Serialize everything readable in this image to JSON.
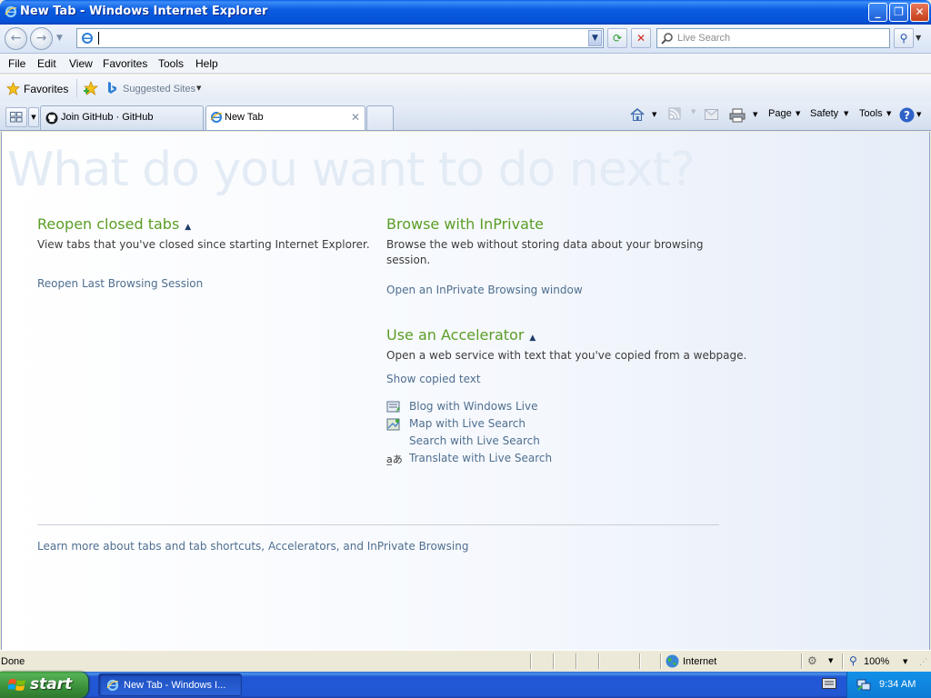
{
  "window": {
    "title": "New Tab - Windows Internet Explorer",
    "minimize": "_",
    "maximize": "❐",
    "close": "✕"
  },
  "navbar": {
    "address_value": "",
    "search_placeholder": "Live Search"
  },
  "menu": [
    "File",
    "Edit",
    "View",
    "Favorites",
    "Tools",
    "Help"
  ],
  "favorites_bar": {
    "favorites_label": "Favorites",
    "suggested_sites_label": "Suggested Sites"
  },
  "tabs": [
    {
      "title": "Join GitHub · GitHub"
    },
    {
      "title": "New Tab"
    }
  ],
  "command_bar": {
    "page": "Page",
    "safety": "Safety",
    "tools": "Tools"
  },
  "content": {
    "headline": "What do you want to do next?",
    "reopen": {
      "title": "Reopen closed tabs",
      "desc": "View tabs that you've closed since starting Internet Explorer.",
      "link": "Reopen Last Browsing Session"
    },
    "inprivate": {
      "title": "Browse with InPrivate",
      "desc": "Browse the web without storing data about your browsing session.",
      "link": "Open an InPrivate Browsing window"
    },
    "accelerator": {
      "title": "Use an Accelerator",
      "desc": "Open a web service with text that you've copied from a webpage.",
      "show_copied": "Show copied text",
      "items": [
        "Blog with Windows Live",
        "Map with Live Search",
        "Search with Live Search",
        "Translate with Live Search"
      ]
    },
    "learn_more": "Learn more about tabs and tab shortcuts, Accelerators, and InPrivate Browsing"
  },
  "status": {
    "text": "Done",
    "zone": "Internet",
    "zoom": "100%"
  },
  "taskbar": {
    "start": "start",
    "task_ie": "New Tab - Windows I...",
    "clock": "9:34 AM"
  },
  "colors": {
    "section_title": "#5b9d26",
    "link": "#4f6f90",
    "title_bar": "#0652d8"
  }
}
